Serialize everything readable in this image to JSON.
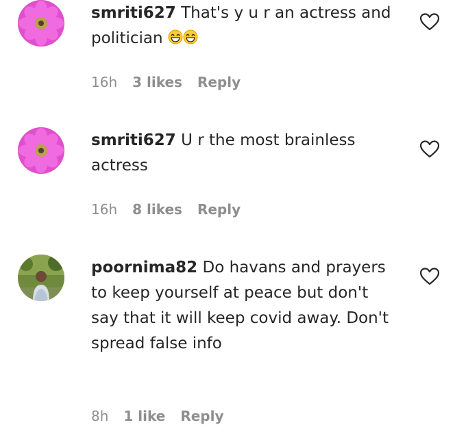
{
  "comments": [
    {
      "username": "smriti627",
      "text": "That's y u r an actress and politician",
      "emoji": "😅😅",
      "time": "16h",
      "likes": "3 likes",
      "reply": "Reply"
    },
    {
      "username": "smriti627",
      "text": "U r the most brainless actress",
      "time": "16h",
      "likes": "8 likes",
      "reply": "Reply"
    },
    {
      "username": "poornima82",
      "text": "Do havans and prayers to keep yourself at peace but don't say that it will keep covid away. Don't spread false info",
      "time": "8h",
      "likes": "1 like",
      "reply": "Reply"
    }
  ],
  "icons": {
    "like": "heart-outline-icon",
    "avatar_1": "pink-flower-avatar",
    "avatar_2": "pink-flower-avatar",
    "avatar_3": "person-photo-avatar"
  },
  "colors": {
    "text": "#262626",
    "meta": "#8e8e8e",
    "flower": "#e043c9",
    "flower_center": "#b8a24a"
  }
}
